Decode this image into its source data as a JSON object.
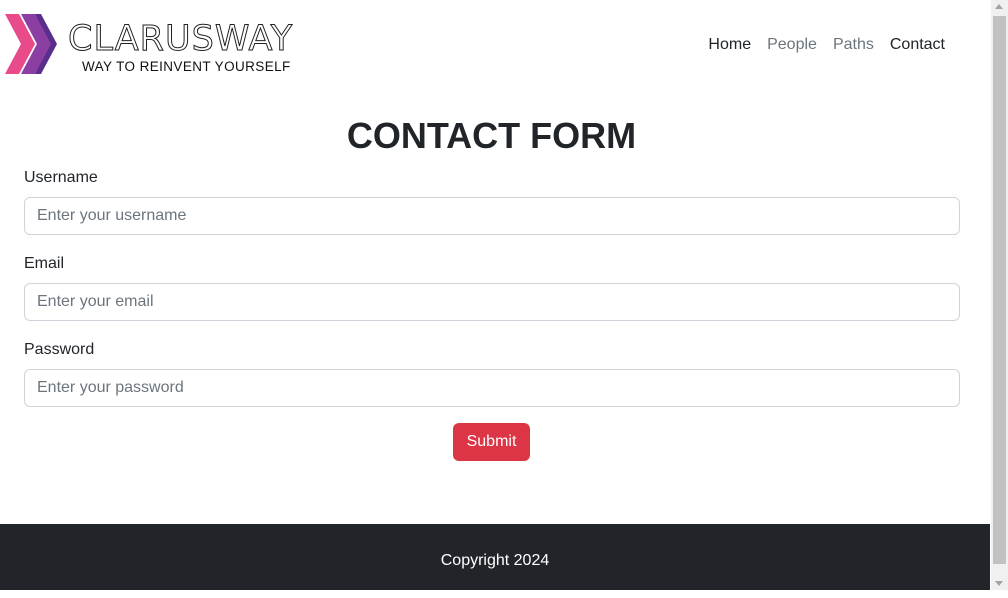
{
  "brand": {
    "name": "CLARUSWAY",
    "tagline": "WAY TO REINVENT YOURSELF",
    "logo_icon": "chevron-arrows-logo",
    "logo_colors": [
      "#e84a8a",
      "#8b3fa3",
      "#5a2e8c"
    ]
  },
  "nav": {
    "items": [
      {
        "label": "Home",
        "active": true
      },
      {
        "label": "People",
        "active": false
      },
      {
        "label": "Paths",
        "active": false
      },
      {
        "label": "Contact",
        "active": true
      }
    ]
  },
  "form": {
    "title": "CONTACT FORM",
    "username": {
      "label": "Username",
      "placeholder": "Enter your username",
      "value": ""
    },
    "email": {
      "label": "Email",
      "placeholder": "Enter your email",
      "value": ""
    },
    "password": {
      "label": "Password",
      "placeholder": "Enter your password",
      "value": ""
    },
    "submit_label": "Submit",
    "submit_color": "#dc3545"
  },
  "footer": {
    "text": "Copyright 2024",
    "background": "#212529"
  }
}
